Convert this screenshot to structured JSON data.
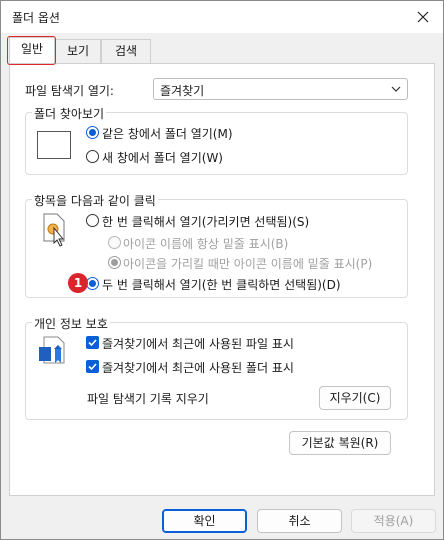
{
  "window": {
    "title": "폴더 옵션"
  },
  "tabs": [
    {
      "label": "일반",
      "active": true
    },
    {
      "label": "보기",
      "active": false
    },
    {
      "label": "검색",
      "active": false
    }
  ],
  "explorer_open": {
    "label": "파일 탐색기 열기:",
    "value": "즐겨찾기"
  },
  "browse_folders": {
    "title": "폴더 찾아보기",
    "options": [
      {
        "label": "같은 창에서 폴더 열기(M)",
        "checked": true
      },
      {
        "label": "새 창에서 폴더 열기(W)",
        "checked": false
      }
    ]
  },
  "click_items": {
    "title": "항목을 다음과 같이 클릭",
    "single_click": "한 번 클릭해서 열기(가리키면 선택됨)(S)",
    "underline_always": "아이콘 이름에 항상 밑줄 표시(B)",
    "underline_hover": "아이콘을 가리킬 때만 아이콘 이름에 밑줄 표시(P)",
    "double_click": "두 번 클릭해서 열기(한 번 클릭하면 선택됨)(D)",
    "badge": "1"
  },
  "privacy": {
    "title": "개인 정보 보호",
    "recent_files": "즐겨찾기에서 최근에 사용된 파일 표시",
    "frequent_folders": "즐겨찾기에서 최근에 사용된 폴더 표시",
    "clear_label": "파일 탐색기 기록 지우기",
    "clear_button": "지우기(C)"
  },
  "restore_defaults": "기본값 복원(R)",
  "footer": {
    "ok": "확인",
    "cancel": "취소",
    "apply": "적용(A)"
  },
  "colors": {
    "accent": "#0a5ed7",
    "badge": "#d9242b",
    "highlight": "#e0262d"
  }
}
